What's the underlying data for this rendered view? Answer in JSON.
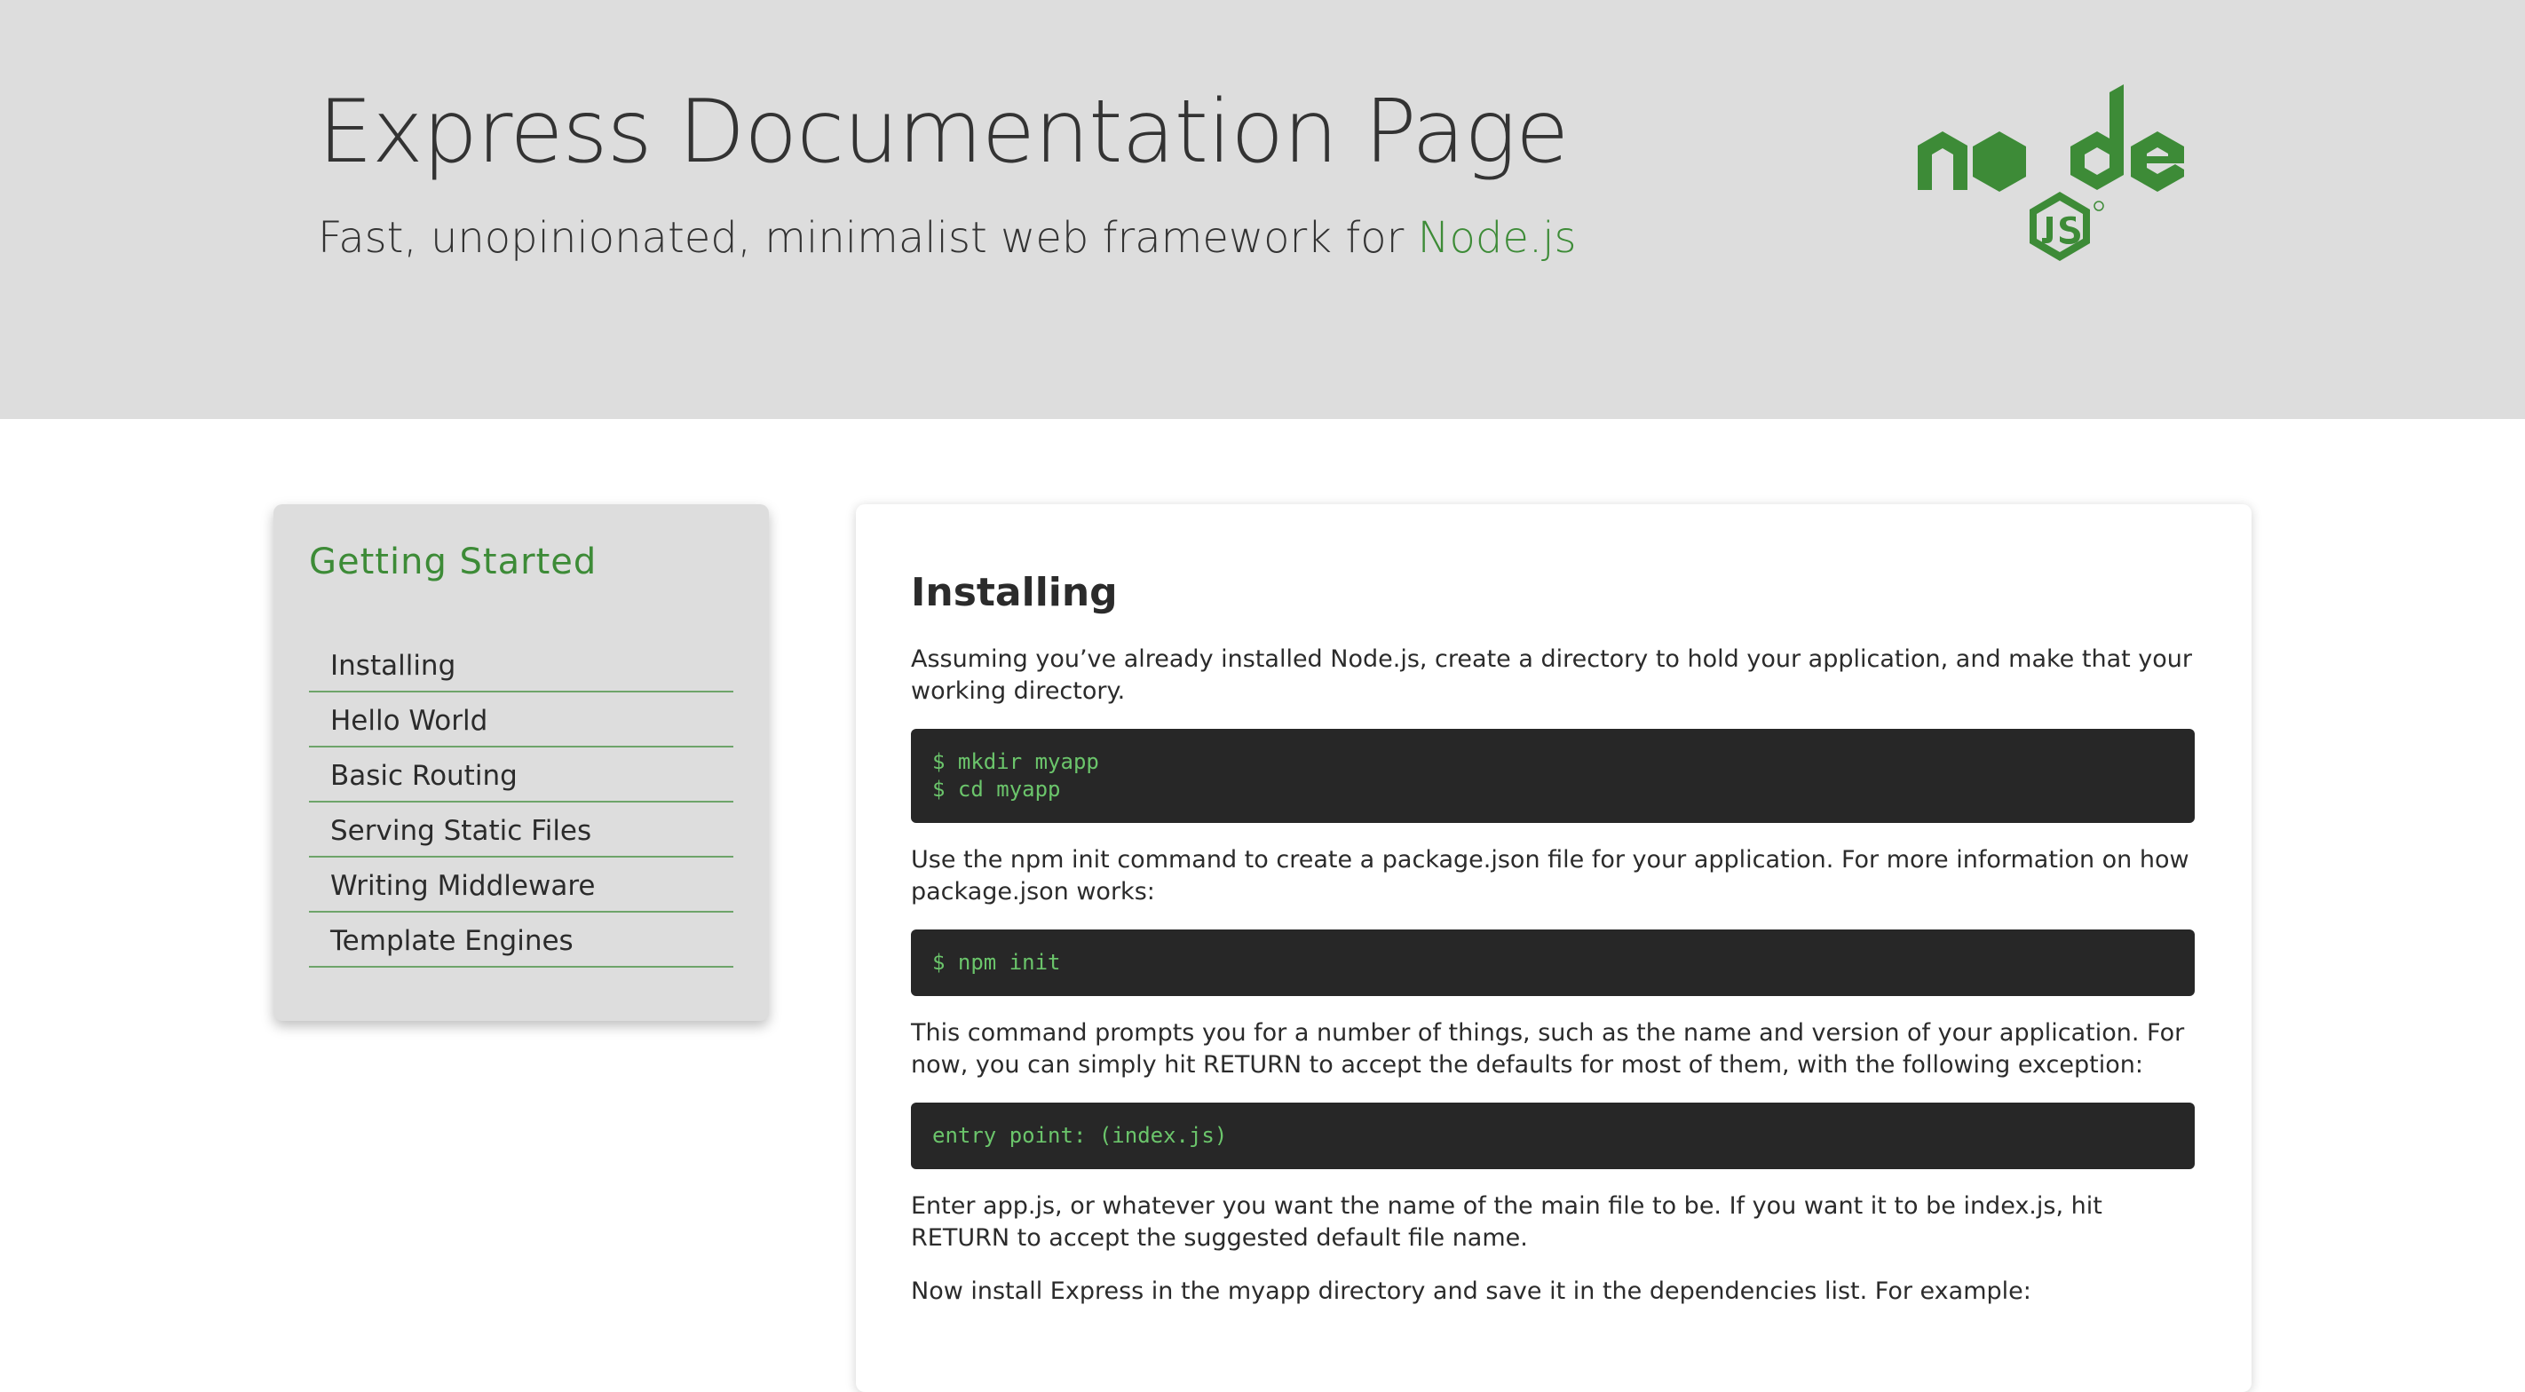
{
  "header": {
    "title": "Express Documentation Page",
    "subtitle_prefix": "Fast, unopinionated, minimalist web framework for ",
    "subtitle_link": "Node.js",
    "logo": {
      "icon": "nodejs-logo-icon",
      "color": "#3d8b37"
    }
  },
  "sidebar": {
    "title": "Getting Started",
    "items": [
      {
        "label": "Installing"
      },
      {
        "label": "Hello World"
      },
      {
        "label": "Basic Routing"
      },
      {
        "label": "Serving Static Files"
      },
      {
        "label": "Writing Middleware"
      },
      {
        "label": "Template Engines"
      }
    ]
  },
  "main": {
    "section_title": "Installing",
    "p1": "Assuming you’ve already installed Node.js, create a directory to hold your application, and make that your working directory.",
    "code1": "$ mkdir myapp\n$ cd myapp",
    "p2": "Use the npm init command to create a package.json file for your application. For more information on how package.json works:",
    "code2": "$ npm init",
    "p3": "This command prompts you for a number of things, such as the name and version of your application. For now, you can simply hit RETURN to accept the defaults for most of them, with the following exception:",
    "code3": "entry point: (index.js)",
    "p4": "Enter app.js, or whatever you want the name of the main file to be. If you want it to be index.js, hit RETURN to accept the suggested default file name.",
    "p5": "Now install Express in the myapp directory and save it in the dependencies list. For example:"
  },
  "colors": {
    "header_bg": "#dddddd",
    "accent_green": "#3d8b37",
    "code_bg": "#272727",
    "code_text": "#6bc56b"
  }
}
